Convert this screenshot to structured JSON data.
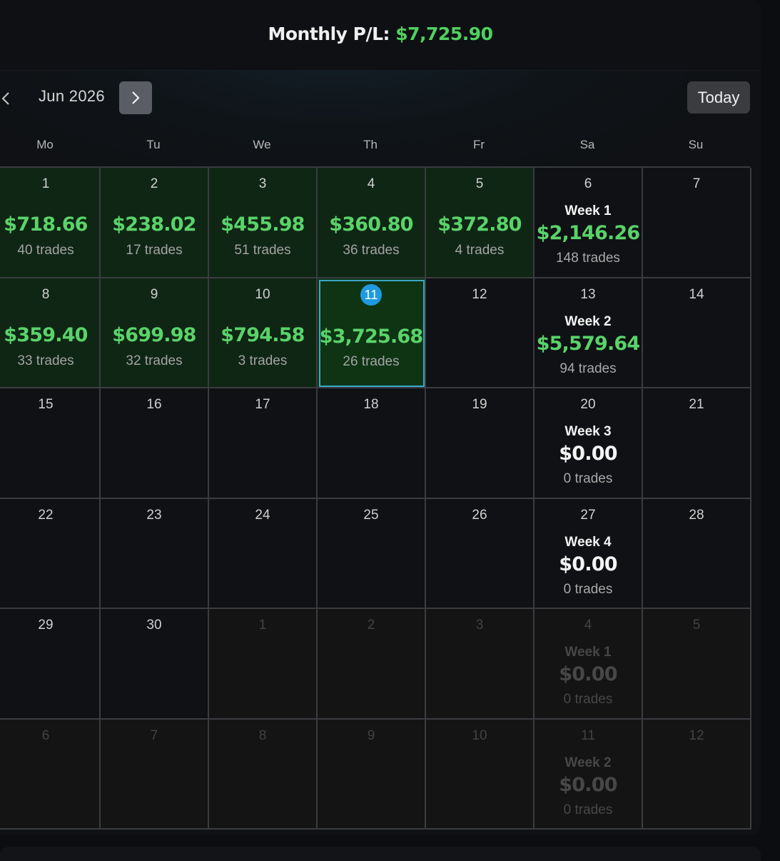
{
  "header": {
    "monthly_label": "Monthly P/L:",
    "monthly_value": "$7,725.90"
  },
  "nav": {
    "month": "Jun 2026",
    "today_label": "Today"
  },
  "weekdays": [
    "Mo",
    "Tu",
    "We",
    "Th",
    "Fr",
    "Sa",
    "Su"
  ],
  "colors": {
    "profit": "#5ad36a",
    "today_marker": "#1f9ae0"
  },
  "weeks": [
    {
      "days": [
        {
          "day": "1",
          "pnl": "$718.66",
          "trades": "40 trades",
          "state": "profit"
        },
        {
          "day": "2",
          "pnl": "$238.02",
          "trades": "17 trades",
          "state": "profit"
        },
        {
          "day": "3",
          "pnl": "$455.98",
          "trades": "51 trades",
          "state": "profit"
        },
        {
          "day": "4",
          "pnl": "$360.80",
          "trades": "36 trades",
          "state": "profit"
        },
        {
          "day": "5",
          "pnl": "$372.80",
          "trades": "4 trades",
          "state": "profit"
        },
        {
          "day": "6",
          "state": "week",
          "week_label": "Week 1",
          "week_pnl": "$2,146.26",
          "week_trades": "148 trades",
          "week_state": "profit"
        },
        {
          "day": "7",
          "state": "empty"
        }
      ]
    },
    {
      "days": [
        {
          "day": "8",
          "pnl": "$359.40",
          "trades": "33 trades",
          "state": "profit"
        },
        {
          "day": "9",
          "pnl": "$699.98",
          "trades": "32 trades",
          "state": "profit"
        },
        {
          "day": "10",
          "pnl": "$794.58",
          "trades": "3 trades",
          "state": "profit"
        },
        {
          "day": "11",
          "pnl": "$3,725.68",
          "trades": "26 trades",
          "state": "today"
        },
        {
          "day": "12",
          "state": "empty"
        },
        {
          "day": "13",
          "state": "week",
          "week_label": "Week 2",
          "week_pnl": "$5,579.64",
          "week_trades": "94 trades",
          "week_state": "profit"
        },
        {
          "day": "14",
          "state": "empty"
        }
      ]
    },
    {
      "days": [
        {
          "day": "15",
          "state": "empty"
        },
        {
          "day": "16",
          "state": "empty"
        },
        {
          "day": "17",
          "state": "empty"
        },
        {
          "day": "18",
          "state": "empty"
        },
        {
          "day": "19",
          "state": "empty"
        },
        {
          "day": "20",
          "state": "week",
          "week_label": "Week 3",
          "week_pnl": "$0.00",
          "week_trades": "0 trades",
          "week_state": "zero"
        },
        {
          "day": "21",
          "state": "empty"
        }
      ]
    },
    {
      "days": [
        {
          "day": "22",
          "state": "empty"
        },
        {
          "day": "23",
          "state": "empty"
        },
        {
          "day": "24",
          "state": "empty"
        },
        {
          "day": "25",
          "state": "empty"
        },
        {
          "day": "26",
          "state": "empty"
        },
        {
          "day": "27",
          "state": "week",
          "week_label": "Week 4",
          "week_pnl": "$0.00",
          "week_trades": "0 trades",
          "week_state": "zero"
        },
        {
          "day": "28",
          "state": "empty"
        }
      ]
    },
    {
      "days": [
        {
          "day": "29",
          "state": "empty"
        },
        {
          "day": "30",
          "state": "empty"
        },
        {
          "day": "1",
          "state": "dim"
        },
        {
          "day": "2",
          "state": "dim"
        },
        {
          "day": "3",
          "state": "dim"
        },
        {
          "day": "4",
          "state": "dimweek",
          "week_label": "Week 1",
          "week_pnl": "$0.00",
          "week_trades": "0 trades",
          "week_state": "zero"
        },
        {
          "day": "5",
          "state": "dim"
        }
      ]
    },
    {
      "days": [
        {
          "day": "6",
          "state": "dim"
        },
        {
          "day": "7",
          "state": "dim"
        },
        {
          "day": "8",
          "state": "dim"
        },
        {
          "day": "9",
          "state": "dim"
        },
        {
          "day": "10",
          "state": "dim"
        },
        {
          "day": "11",
          "state": "dimweek",
          "week_label": "Week 2",
          "week_pnl": "$0.00",
          "week_trades": "0 trades",
          "week_state": "zero"
        },
        {
          "day": "12",
          "state": "dim"
        }
      ]
    }
  ]
}
